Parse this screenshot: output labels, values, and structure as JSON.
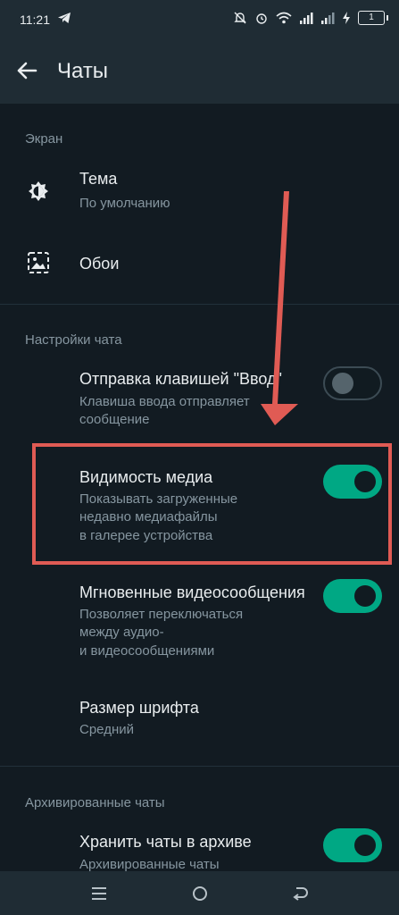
{
  "status_bar": {
    "time": "11:21",
    "battery_level": "1"
  },
  "app_bar": {
    "title": "Чаты"
  },
  "sections": {
    "screen": {
      "header": "Экран",
      "theme": {
        "title": "Тема",
        "subtitle": "По умолчанию"
      },
      "wallpaper": {
        "title": "Обои"
      }
    },
    "chat_settings": {
      "header": "Настройки чата",
      "enter_send": {
        "title": "Отправка клавишей \"Ввод\"",
        "subtitle_line1": "Клавиша ввода отправляет",
        "subtitle_line2": "сообщение",
        "enabled": false
      },
      "media_visibility": {
        "title": "Видимость медиа",
        "subtitle_line1": "Показывать загруженные",
        "subtitle_line2": "недавно медиафайлы",
        "subtitle_line3": "в галерее устройства",
        "enabled": true
      },
      "instant_video": {
        "title": "Мгновенные видеосообщения",
        "subtitle_line1": "Позволяет переключаться",
        "subtitle_line2": "между аудио-",
        "subtitle_line3": "и видеосообщениями",
        "enabled": true
      },
      "font_size": {
        "title": "Размер шрифта",
        "subtitle": "Средний"
      }
    },
    "archived": {
      "header": "Архивированные чаты",
      "keep_archived": {
        "title": "Хранить чаты в архиве",
        "subtitle": "Архивированные чаты",
        "enabled": true
      }
    }
  },
  "colors": {
    "background": "#121b22",
    "header": "#1f2c34",
    "accent": "#00a884",
    "annotation": "#e05b54"
  }
}
